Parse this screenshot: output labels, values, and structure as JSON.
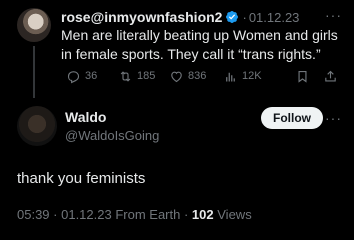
{
  "parent_tweet": {
    "display_name": "rose@inmyownfashion2",
    "date": "01.12.23",
    "separator": "·",
    "text": "Men are literally beating up Women and girls in female sports. They call it “trans rights.”",
    "more": "···",
    "replies": "36",
    "retweets": "185",
    "likes": "836",
    "views": "12K"
  },
  "tweet": {
    "display_name": "Waldo",
    "handle": "@WaldoIsGoing",
    "follow_label": "Follow",
    "more": "···",
    "text": "thank you feminists",
    "time": "05:39",
    "date_source": "· 01.12.23 From Earth ·",
    "views_count": "102",
    "views_label": "Views"
  },
  "colors": {
    "background": "#000000",
    "text": "#e7e9ea",
    "muted": "#71767b",
    "verified": "#1d9bf0"
  }
}
